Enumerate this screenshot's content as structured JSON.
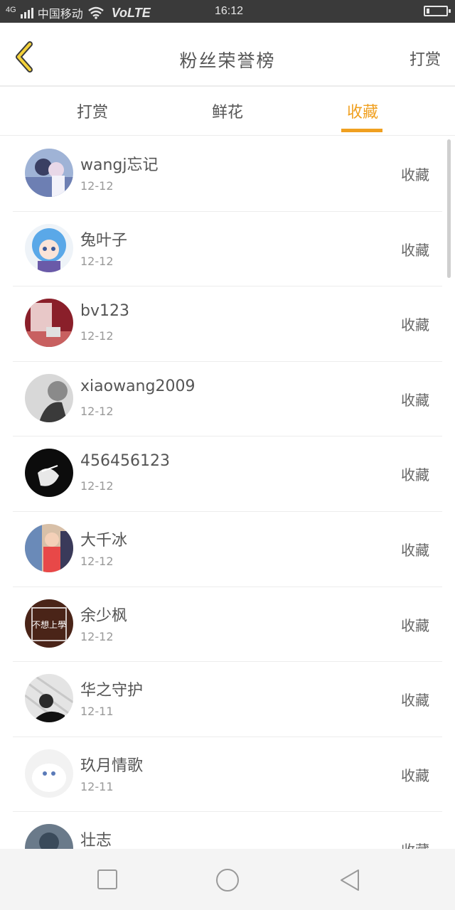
{
  "status_bar": {
    "network": "4G",
    "carrier": "中国移动",
    "volte": "VoLTE",
    "time": "16:12"
  },
  "header": {
    "title": "粉丝荣誉榜",
    "action_label": "打赏",
    "back_icon": "chevron-left-icon"
  },
  "tabs": [
    {
      "label": "打赏",
      "active": false
    },
    {
      "label": "鲜花",
      "active": false
    },
    {
      "label": "收藏",
      "active": true
    }
  ],
  "colors": {
    "accent": "#f0a020",
    "text": "#555555",
    "muted": "#999999"
  },
  "list": [
    {
      "name": "wangj忘记",
      "date": "12-12",
      "type": "收藏"
    },
    {
      "name": "兔叶子",
      "date": "12-12",
      "type": "收藏"
    },
    {
      "name": "bv123",
      "date": "12-12",
      "type": "收藏"
    },
    {
      "name": "xiaowang2009",
      "date": "12-12",
      "type": "收藏"
    },
    {
      "name": "456456123",
      "date": "12-12",
      "type": "收藏"
    },
    {
      "name": "大千冰",
      "date": "12-12",
      "type": "收藏"
    },
    {
      "name": "余少枫",
      "date": "12-12",
      "type": "收藏"
    },
    {
      "name": "华之守护",
      "date": "12-11",
      "type": "收藏"
    },
    {
      "name": "玖月情歌",
      "date": "12-11",
      "type": "收藏"
    },
    {
      "name": "壮志",
      "date": "",
      "type": "收藏"
    }
  ],
  "avatar_overlay_text": "不想上學"
}
